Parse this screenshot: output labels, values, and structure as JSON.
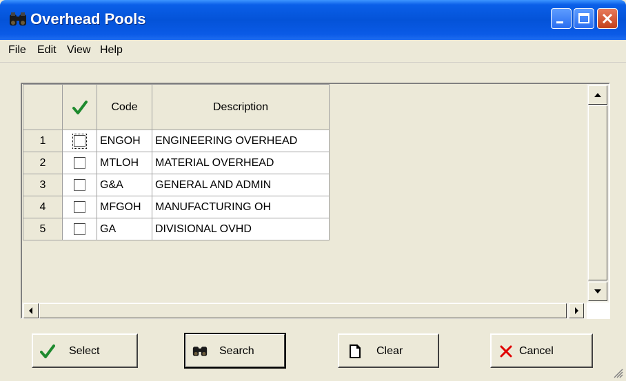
{
  "window": {
    "title": "Overhead Pools",
    "controls": [
      "minimize",
      "maximize",
      "close"
    ]
  },
  "menu": [
    "File",
    "Edit",
    "View",
    "Help"
  ],
  "grid": {
    "columns": [
      "",
      "✓",
      "Code",
      "Description"
    ],
    "rows": [
      {
        "num": "1",
        "checked": false,
        "code": "ENGOH",
        "description": "ENGINEERING OVERHEAD"
      },
      {
        "num": "2",
        "checked": false,
        "code": "MTLOH",
        "description": "MATERIAL OVERHEAD"
      },
      {
        "num": "3",
        "checked": false,
        "code": "G&A",
        "description": "GENERAL AND ADMIN"
      },
      {
        "num": "4",
        "checked": false,
        "code": "MFGOH",
        "description": "MANUFACTURING OH"
      },
      {
        "num": "5",
        "checked": false,
        "code": "GA",
        "description": "DIVISIONAL OVHD"
      }
    ]
  },
  "buttons": {
    "select": "Select",
    "search": "Search",
    "clear": "Clear",
    "cancel": "Cancel"
  },
  "colors": {
    "titlebar": "#0453d8",
    "checkmark": "#1e8a2e",
    "cancel_x": "#e00000"
  }
}
